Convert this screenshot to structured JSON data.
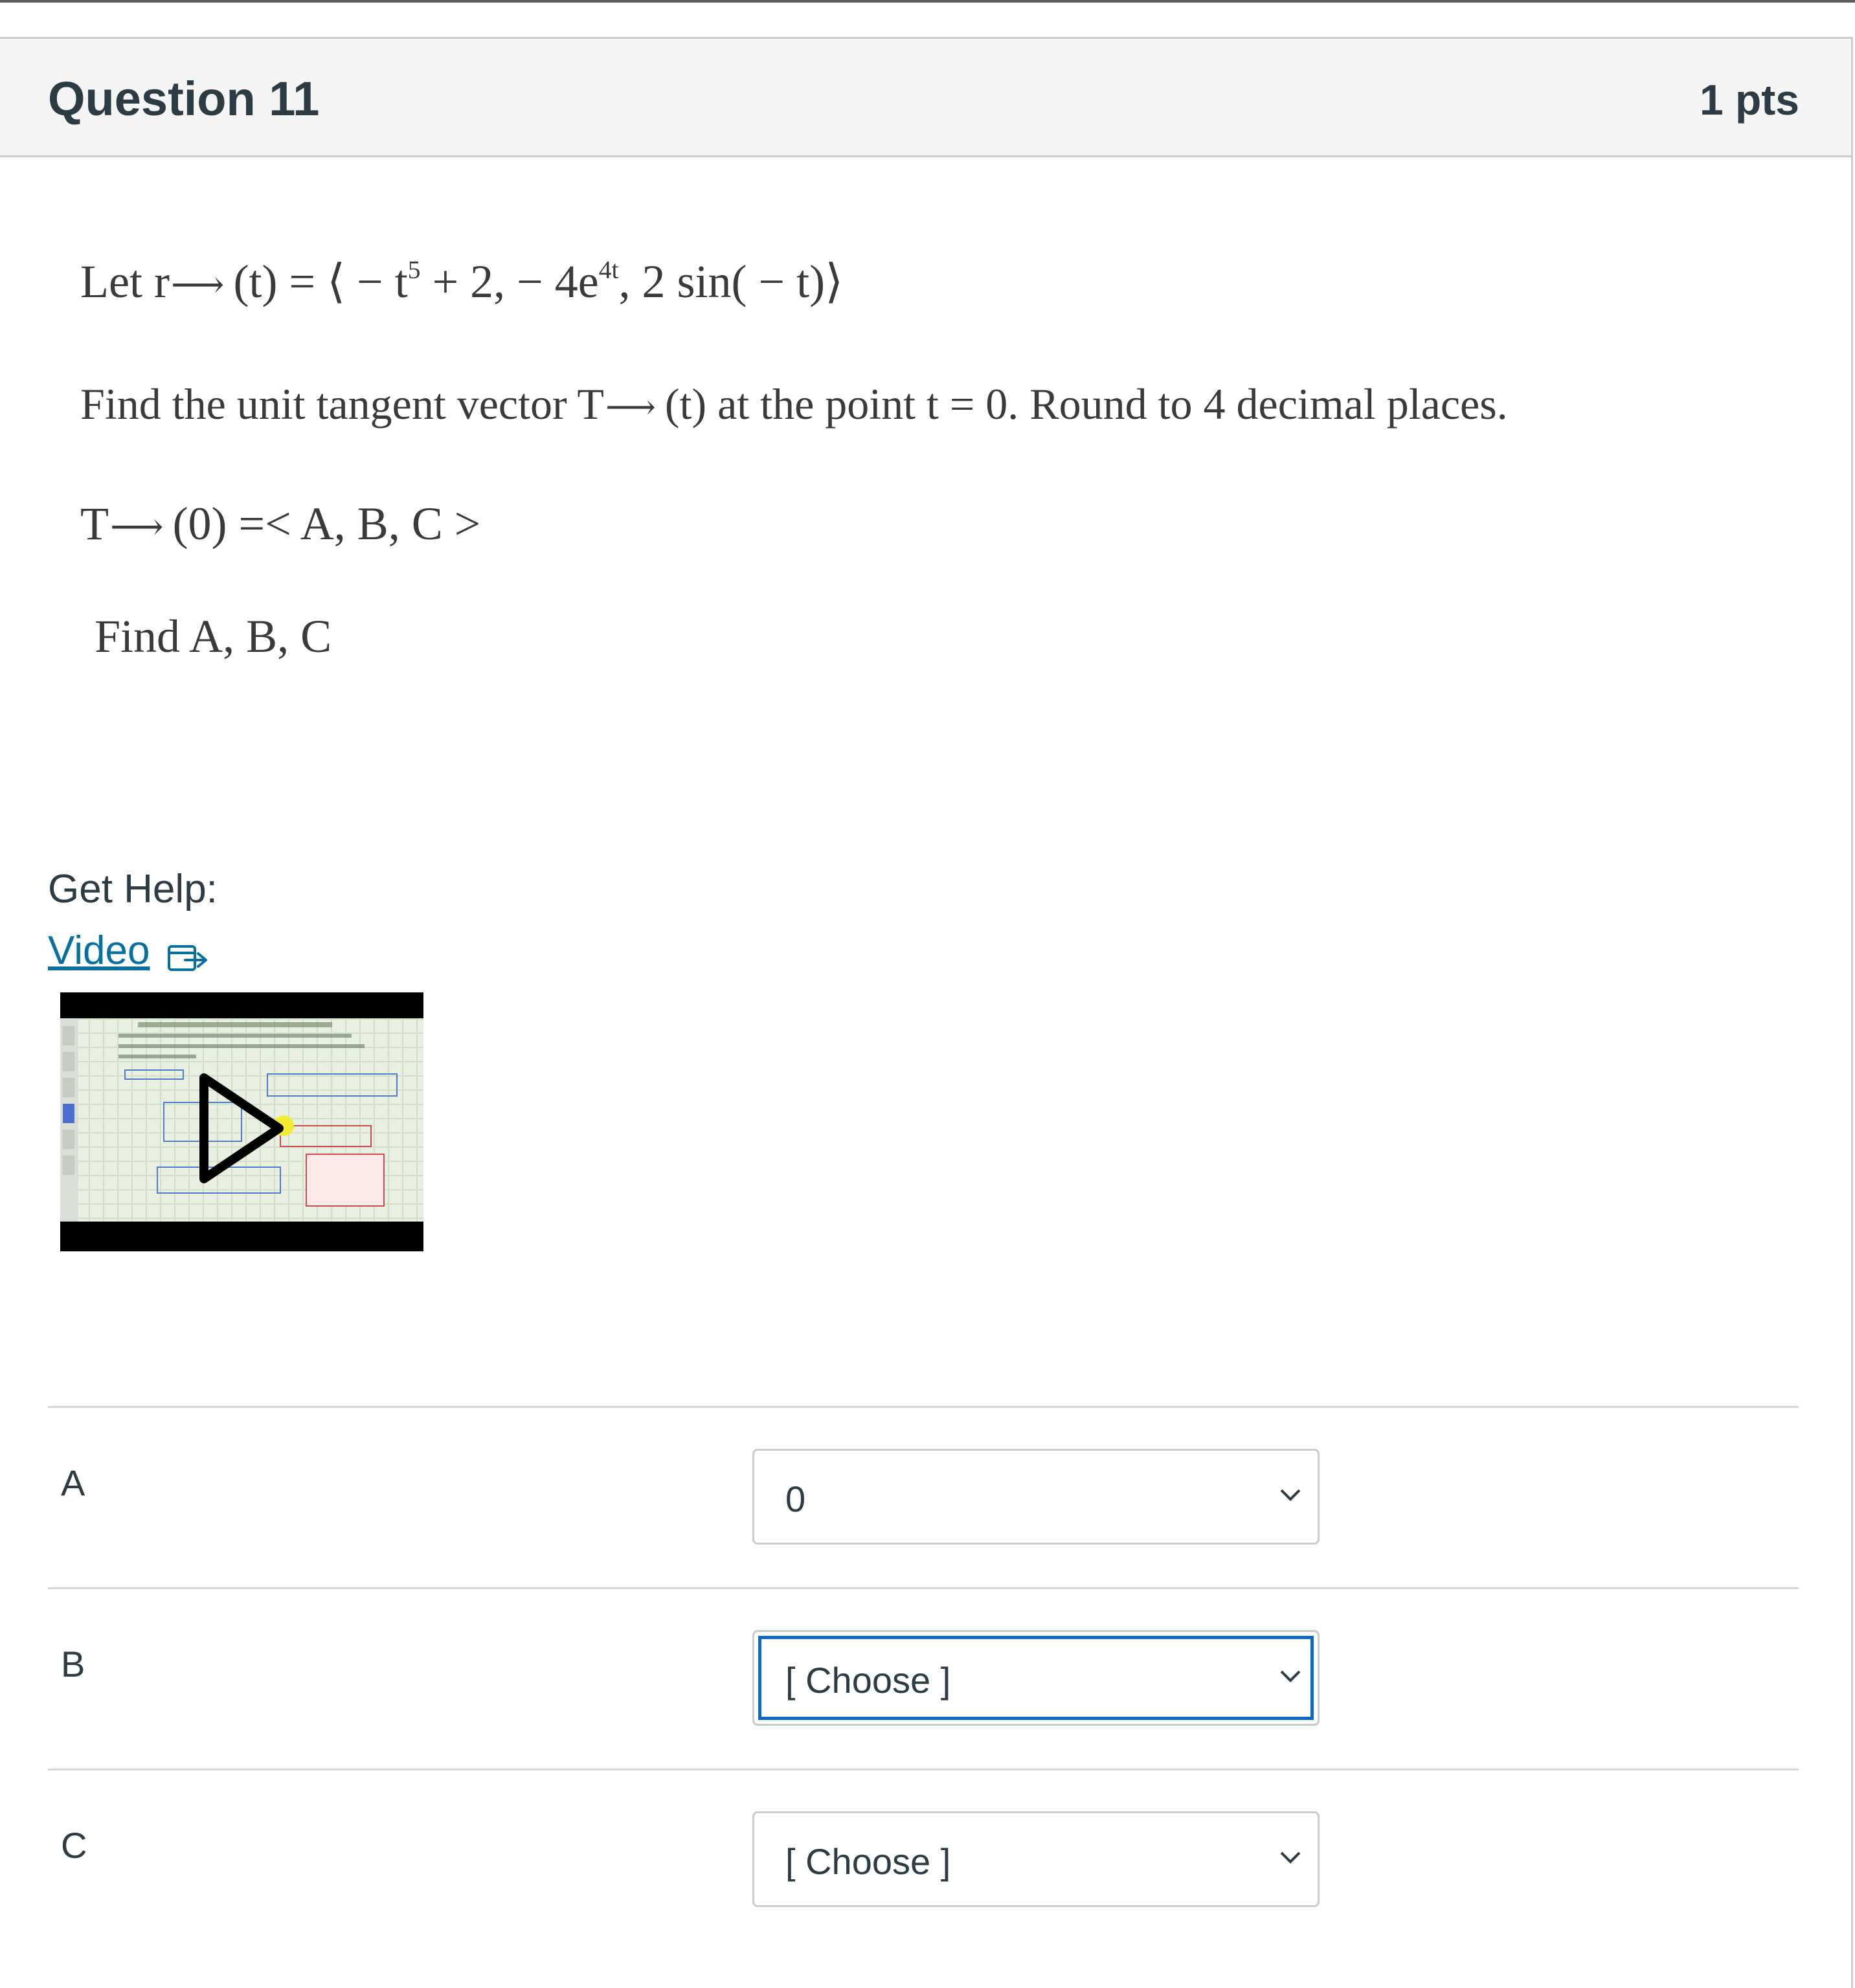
{
  "question": {
    "title": "Question 11",
    "points": "1 pts"
  },
  "problem": {
    "line1": {
      "prefix": "Let r",
      "mid": "(t) = ⟨ − t",
      "exp1": "5",
      "mid2": " + 2,  − 4e",
      "exp2": "4t",
      "suffix": ", 2 sin( − t)⟩"
    },
    "line2": {
      "prefix": "Find the unit tangent vector T",
      "suffix": "(t) at the point t = 0. Round to 4 decimal places."
    },
    "line3": {
      "prefix": "T",
      "suffix": "(0) =< A, B, C >"
    },
    "line4": "Find A, B, C",
    "arrow": "⟶"
  },
  "help": {
    "label": "Get Help:",
    "video_link": "Video"
  },
  "answers": [
    {
      "label": "A",
      "selected": "0"
    },
    {
      "label": "B",
      "selected": "[ Choose ]"
    },
    {
      "label": "C",
      "selected": "[ Choose ]"
    }
  ],
  "colors": {
    "link": "#0770a3",
    "focus_ring": "#0b6bcb",
    "header_bg": "#f5f5f5"
  },
  "icons": {
    "external_link": "external-link-icon",
    "play": "play-icon",
    "dropdown": "chevron-down-icon"
  }
}
